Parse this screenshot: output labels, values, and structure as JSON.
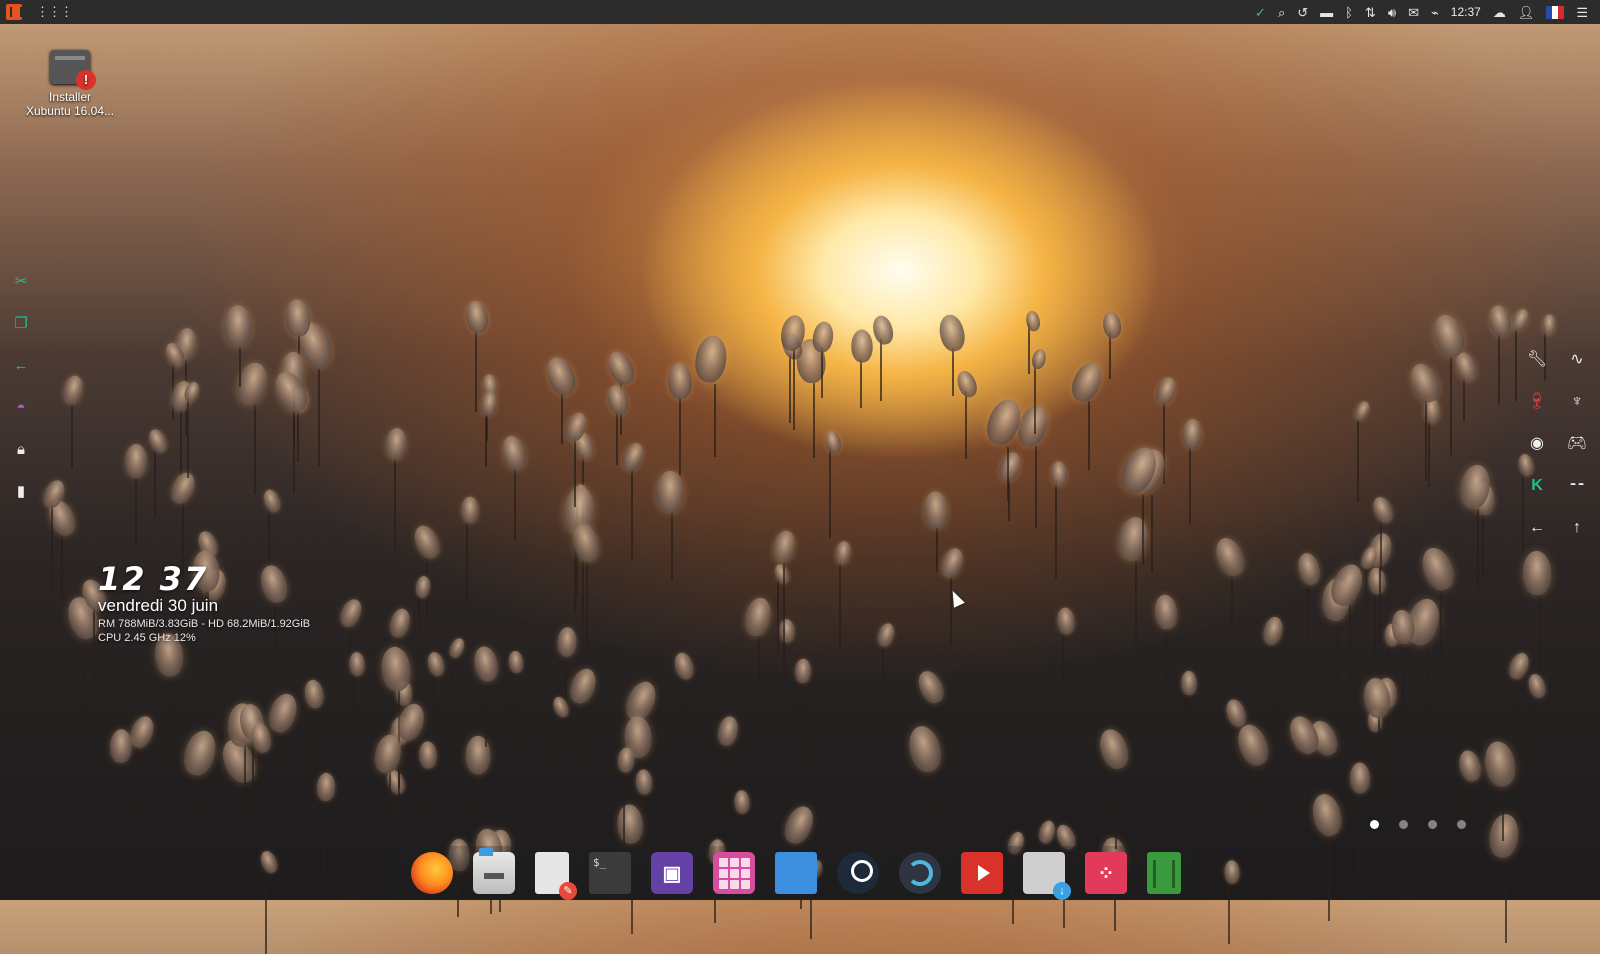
{
  "top_panel": {
    "clock": "12:37"
  },
  "desktop": {
    "icons": [
      {
        "label_line1": "Installer",
        "label_line2": "Xubuntu 16.04..."
      }
    ]
  },
  "conky": {
    "time": "12 37",
    "date": "vendredi 30 juin",
    "mem_line": "RM 788MiB/3.83GiB - HD 68.2MiB/1.92GiB",
    "cpu_line": "CPU 2.45 GHz 12%"
  },
  "workspaces": {
    "count": 4,
    "active_index": 0
  },
  "left_dock_icons": [
    "scissors-icon",
    "window-icon",
    "back-arrow-icon",
    "mask-icon",
    "lock-icon",
    "bar-chart-icon"
  ],
  "right_dock_icons": [
    "wrench-icon",
    "pulse-icon",
    "wine-glass-icon",
    "goblet-icon",
    "eye-icon",
    "gamepad-icon",
    "k-icon",
    "dashes-icon",
    "left-arrow-icon",
    "up-arrow-icon"
  ],
  "bottom_dock_apps": [
    "firefox",
    "files",
    "text-editor",
    "terminal",
    "twitch",
    "app-grid",
    "desktop",
    "steam",
    "backup",
    "youtube",
    "software-install",
    "mixer",
    "trash"
  ],
  "colors": {
    "panel_bg": "#2c2c2c",
    "accent_orange": "#e5541f",
    "accent_teal": "#1dbf8f"
  }
}
